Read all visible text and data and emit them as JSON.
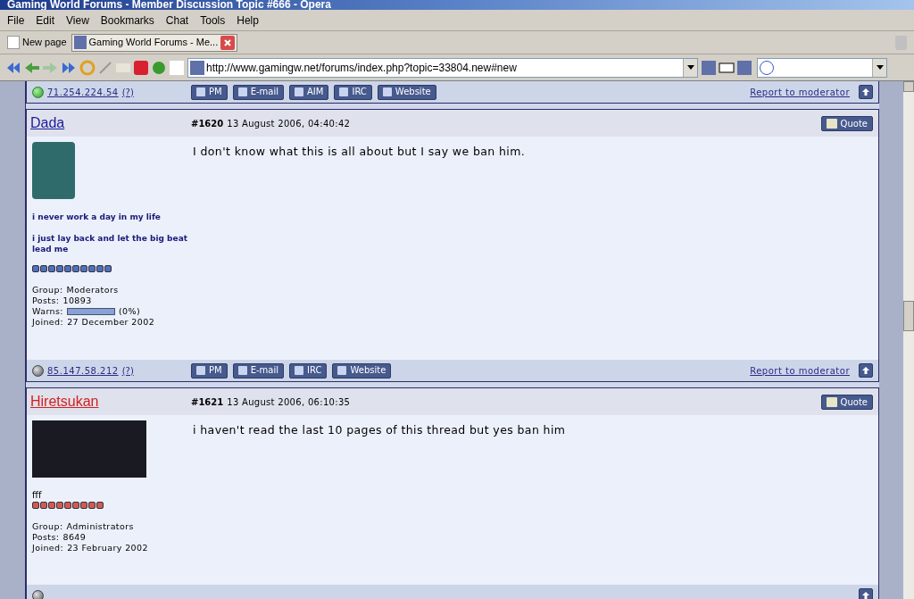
{
  "window": {
    "title": "Gaming World Forums - Member Discussion Topic #666 - Opera"
  },
  "menu": [
    "File",
    "Edit",
    "View",
    "Bookmarks",
    "Chat",
    "Tools",
    "Help"
  ],
  "tabs": [
    {
      "label": "New page",
      "selected": false,
      "closable": false
    },
    {
      "label": "Gaming World Forums - Me...",
      "selected": true,
      "closable": true
    }
  ],
  "address": {
    "url": "http://www.gamingw.net/forums/index.php?topic=33804.new#new"
  },
  "top_footer": {
    "online": true,
    "ip": "71.254.224.54",
    "help": "(?)",
    "buttons": [
      "PM",
      "E-mail",
      "AIM",
      "IRC",
      "Website"
    ],
    "report": "Report to moderator"
  },
  "posts": [
    {
      "author": "Dada",
      "color": "#1a1a9a",
      "number": "#1620",
      "date": "13 August 2006, 04:40:42",
      "quote": "Quote",
      "text": "I don't know what this is all about but I say we ban him.",
      "avatar": {
        "kind": "portrait"
      },
      "signature": [
        "i never work a day in my life",
        "i just lay back and let the big beat lead me"
      ],
      "pips": {
        "stars": 10,
        "color": "#4f6fc0"
      },
      "info": [
        {
          "kind": "text",
          "label": "Group:",
          "value": "Moderators"
        },
        {
          "kind": "text",
          "label": "Posts:",
          "value": "10893"
        },
        {
          "kind": "meter",
          "label": "Warns:",
          "level": 0,
          "value": "(0%)"
        },
        {
          "kind": "text",
          "label": "Joined:",
          "value": "27 December 2002"
        }
      ],
      "footer": {
        "online": false,
        "ip": "85.147.58.212",
        "help": "(?)",
        "buttons": [
          "PM",
          "E-mail",
          "IRC",
          "Website"
        ],
        "report": "Report to moderator"
      }
    },
    {
      "author": "Hiretsukan",
      "color": "#d42020",
      "number": "#1621",
      "date": "13 August 2006, 06:10:35",
      "quote": "Quote",
      "text": "i haven't read the last 10 pages of this thread but yes ban him",
      "avatar": {
        "kind": "banner"
      },
      "signature": [
        "fff"
      ],
      "pips": {
        "stars": 9,
        "color": "#d05a5a"
      },
      "info": [
        {
          "kind": "text",
          "label": "Group:",
          "value": "Administrators"
        },
        {
          "kind": "text",
          "label": "Posts:",
          "value": "8649"
        },
        {
          "kind": "text",
          "label": "Joined:",
          "value": "23 February 2002"
        }
      ],
      "footer": {
        "online": false
      }
    }
  ]
}
